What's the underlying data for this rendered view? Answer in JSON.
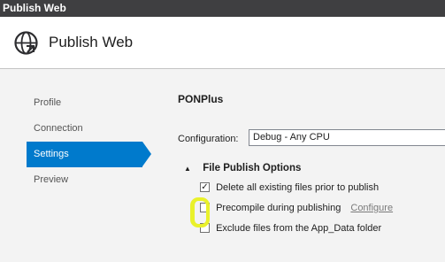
{
  "window": {
    "title": "Publish Web"
  },
  "header": {
    "title": "Publish Web",
    "icon": "globe-arrow-icon"
  },
  "nav": {
    "items": [
      {
        "label": "Profile",
        "active": false
      },
      {
        "label": "Connection",
        "active": false
      },
      {
        "label": "Settings",
        "active": true
      },
      {
        "label": "Preview",
        "active": false
      }
    ]
  },
  "settings": {
    "profile_name": "PONPlus",
    "configuration_label": "Configuration:",
    "configuration_value": "Debug - Any CPU",
    "section_title": "File Publish Options",
    "options": [
      {
        "label": "Delete all existing files prior to publish",
        "checked": true
      },
      {
        "label": "Precompile during publishing",
        "checked": false,
        "link": "Configure"
      },
      {
        "label": "Exclude files from the App_Data folder",
        "checked": false
      }
    ]
  },
  "colors": {
    "accent": "#007acc",
    "titlebar": "#3f3f41",
    "highlight": "#e9f12b"
  }
}
